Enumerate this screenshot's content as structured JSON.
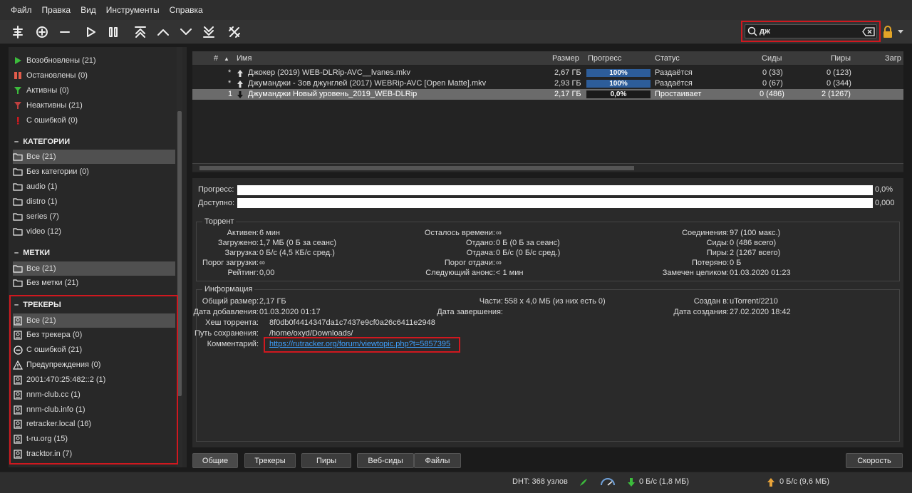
{
  "menu": [
    "Файл",
    "Правка",
    "Вид",
    "Инструменты",
    "Справка"
  ],
  "toolbar": {
    "icons": [
      "add-link-icon",
      "add-icon",
      "remove-icon",
      "play-icon",
      "pause-icon",
      "move-top-icon",
      "move-up-icon",
      "move-down-icon",
      "move-bottom-icon",
      "settings-icon"
    ]
  },
  "search": {
    "value": "дж"
  },
  "sidebar": {
    "status": [
      {
        "label": "Возобновлены (21)",
        "icon": "resume-icon",
        "color": "#3cbc3c"
      },
      {
        "label": "Остановлены (0)",
        "icon": "pause-icon",
        "color": "#e25c4b"
      },
      {
        "label": "Активны (0)",
        "icon": "filter-icon",
        "color": "#3cbc3c"
      },
      {
        "label": "Неактивны (21)",
        "icon": "filter-icon",
        "color": "#c04040"
      },
      {
        "label": "С ошибкой (0)",
        "icon": "error-icon",
        "color": "#d0181f"
      }
    ],
    "categories_header": "КАТЕГОРИИ",
    "categories": [
      "Все (21)",
      "Без категории (0)",
      "audio (1)",
      "distro (1)",
      "series (7)",
      "video (12)"
    ],
    "tags_header": "МЕТКИ",
    "tags": [
      "Все (21)",
      "Без метки (21)"
    ],
    "trackers_header": "ТРЕКЕРЫ",
    "trackers": [
      "Все (21)",
      "Без трекера (0)",
      "С ошибкой (21)",
      "Предупреждения (0)",
      "2001:470:25:482::2 (1)",
      "nnm-club.cc (1)",
      "nnm-club.info (1)",
      "retracker.local (16)",
      "t-ru.org (15)",
      "tracktor.in (7)"
    ]
  },
  "table": {
    "headers": {
      "num": "#",
      "name": "Имя",
      "size": "Размер",
      "progress": "Прогресс",
      "status": "Статус",
      "seeds": "Сиды",
      "peers": "Пиры",
      "down": "Загр"
    },
    "rows": [
      {
        "num": "*",
        "name": "Джокер (2019) WEB-DLRip-AVC__lvanes.mkv",
        "size": "2,67 ГБ",
        "progress": "100%",
        "progress_value": 1.0,
        "status": "Раздаётся",
        "seeds": "0 (33)",
        "peers": "0 (123)",
        "dir": "up"
      },
      {
        "num": "*",
        "name": "Джуманджи - Зов джунглей (2017) WEBRip-AVC [Open Matte].mkv",
        "size": "2,93 ГБ",
        "progress": "100%",
        "progress_value": 1.0,
        "status": "Раздаётся",
        "seeds": "0 (67)",
        "peers": "0 (344)",
        "dir": "up"
      },
      {
        "num": "1",
        "name": "Джуманджи Новый уровень_2019_WEB-DLRip",
        "size": "2,17 ГБ",
        "progress": "0,0%",
        "progress_value": 0.0,
        "status": "Простаивает",
        "seeds": "0 (486)",
        "peers": "2 (1267)",
        "dir": "down"
      }
    ]
  },
  "details": {
    "progress_label": "Прогресс:",
    "progress_value": "0,0%",
    "available_label": "Доступно:",
    "available_value": "0,000",
    "torrent_group": "Торрент",
    "t": {
      "active_l": "Активен:",
      "active_v": "6 мин",
      "remaining_l": "Осталось времени:",
      "remaining_v": "∞",
      "connections_l": "Соединения:",
      "connections_v": "97 (100 макс.)",
      "downloaded_l": "Загружено:",
      "downloaded_v": "1,7 МБ (0 Б за сеанс)",
      "uploaded_l": "Отдано:",
      "uploaded_v": "0 Б (0 Б за сеанс)",
      "seeds_l": "Сиды:",
      "seeds_v": "0 (486 всего)",
      "dlspeed_l": "Загрузка:",
      "dlspeed_v": "0 Б/с (4,5 КБ/с сред.)",
      "ulspeed_l": "Отдача:",
      "ulspeed_v": "0 Б/с (0 Б/с сред.)",
      "peers_l": "Пиры:",
      "peers_v": "2 (1267 всего)",
      "dllimit_l": "Порог загрузки:",
      "dllimit_v": "∞",
      "ullimit_l": "Порог отдачи:",
      "ullimit_v": "∞",
      "wasted_l": "Потеряно:",
      "wasted_v": "0 Б",
      "ratio_l": "Рейтинг:",
      "ratio_v": "0,00",
      "reannounce_l": "Следующий анонс:",
      "reannounce_v": "< 1 мин",
      "lastseen_l": "Замечен целиком:",
      "lastseen_v": "01.03.2020 01:23"
    },
    "info_group": "Информация",
    "i": {
      "total_l": "Общий размер:",
      "total_v": "2,17 ГБ",
      "pieces_l": "Части:",
      "pieces_v": "558 x 4,0 МБ (из них есть 0)",
      "createdby_l": "Создан в:",
      "createdby_v": "uTorrent/2210",
      "added_l": "Дата добавления:",
      "added_v": "01.03.2020 01:17",
      "completed_l": "Дата завершения:",
      "completed_v": "",
      "createdon_l": "Дата создания:",
      "createdon_v": "27.02.2020 18:42",
      "hash_l": "Хеш торрента:",
      "hash_v": "8f0db0f4414347da1c7437e9cf0a26c6411e2948",
      "path_l": "Путь сохранения:",
      "path_v": "/home/oxyd/Downloads/",
      "comment_l": "Комментарий:",
      "comment_v": "https://rutracker.org/forum/viewtopic.php?t=5857395"
    }
  },
  "tabs": [
    "Общие",
    "Трекеры",
    "Пиры",
    "Веб-сиды",
    "Файлы"
  ],
  "speed_button": "Скорость",
  "status": {
    "dht": "DHT: 368 узлов",
    "down": "0 Б/с (1,8 МБ)",
    "up": "0 Б/с (9,6 МБ)"
  },
  "colors": {
    "accent": "#2d5d9a",
    "highlight_border": "#d0181f",
    "link": "#3ea0ff"
  }
}
